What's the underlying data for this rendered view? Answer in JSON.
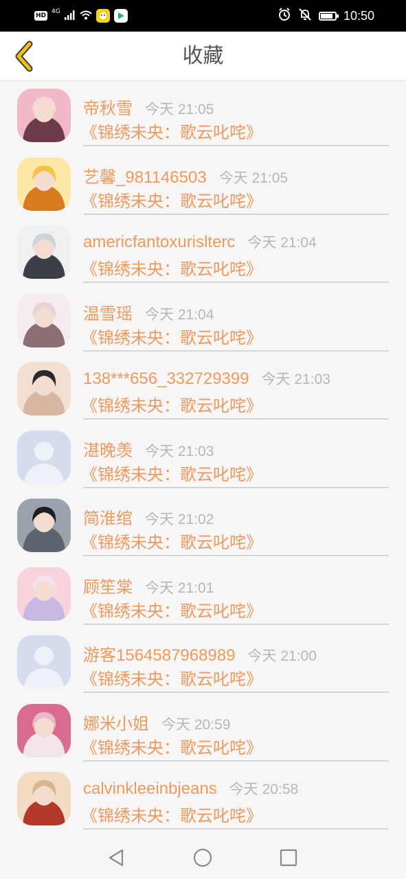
{
  "status_bar": {
    "hd": "HD",
    "network": "4G",
    "time": "10:50",
    "battery_level": 0.85,
    "icons": [
      "hd-icon",
      "signal-icon",
      "wifi-icon",
      "app-notification-icon",
      "video-app-icon",
      "alarm-icon",
      "mute-icon",
      "battery-icon"
    ]
  },
  "header": {
    "title": "收藏",
    "back_icon": "chevron-left-icon"
  },
  "colors": {
    "accent": "#ef9a5c",
    "back_arrow": "#f4c20d",
    "time_text": "#b7b7b7",
    "divider": "#d6d3d3"
  },
  "favorites": [
    {
      "name": "帝秋雪",
      "time": "今天 21:05",
      "book": "《锦绣未央：歌云叱咤》",
      "avatar": "anime-girl-avatar"
    },
    {
      "name": "艺馨_981146503",
      "time": "今天 21:05",
      "book": "《锦绣未央：歌云叱咤》",
      "avatar": "illustrated-avatar"
    },
    {
      "name": "americfantoxurislterc",
      "time": "今天 21:04",
      "book": "《锦绣未央：歌云叱咤》",
      "avatar": "photo-avatar"
    },
    {
      "name": "温雪瑶",
      "time": "今天 21:04",
      "book": "《锦绣未央：歌云叱咤》",
      "avatar": "photo-avatar"
    },
    {
      "name": "138***656_332729399",
      "time": "今天 21:03",
      "book": "《锦绣未央：歌云叱咤》",
      "avatar": "photo-avatar"
    },
    {
      "name": "湛晚羡",
      "time": "今天 21:03",
      "book": "《锦绣未央：歌云叱咤》",
      "avatar": "default-avatar"
    },
    {
      "name": "简淮绾",
      "time": "今天 21:02",
      "book": "《锦绣未央：歌云叱咤》",
      "avatar": "photo-avatar"
    },
    {
      "name": "顾笙棠",
      "time": "今天 21:01",
      "book": "《锦绣未央：歌云叱咤》",
      "avatar": "anime-avatar"
    },
    {
      "name": "游客1564587968989",
      "time": "今天 21:00",
      "book": "《锦绣未央：歌云叱咤》",
      "avatar": "default-avatar"
    },
    {
      "name": "娜米小姐",
      "time": "今天 20:59",
      "book": "《锦绣未央：歌云叱咤》",
      "avatar": "photo-avatar"
    },
    {
      "name": "calvinkleeinbjeans",
      "time": "今天 20:58",
      "book": "《锦绣未央：歌云叱咤》",
      "avatar": "photo-avatar"
    }
  ],
  "nav_bar": {
    "icons": [
      "back-triangle-icon",
      "home-circle-icon",
      "recents-square-icon"
    ]
  }
}
